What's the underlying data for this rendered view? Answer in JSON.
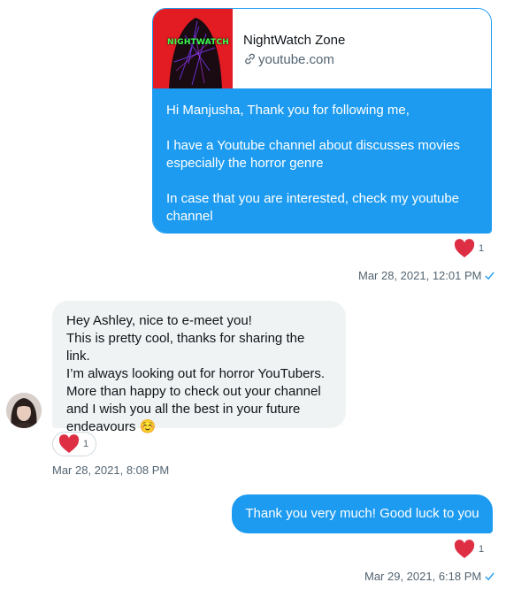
{
  "messages": [
    {
      "direction": "outgoing",
      "link_card": {
        "title": "NightWatch Zone",
        "domain": "youtube.com",
        "thumbnail_logo": "NIGHTWATCH"
      },
      "paragraphs": [
        "Hi Manjusha, Thank you for following me,",
        "I have a Youtube channel about discusses movies especially the horror genre",
        "In case that you are interested, check my youtube channel"
      ],
      "reaction": {
        "icon": "heart-icon",
        "count": "1"
      },
      "timestamp": "Mar 28, 2021, 12:01 PM"
    },
    {
      "direction": "incoming",
      "lines": [
        "Hey Ashley, nice to e-meet you!",
        "This is pretty cool, thanks for sharing the link.",
        "I’m always looking out for horror YouTubers.",
        "More than happy to check out your channel",
        "and I wish you all the best in your future",
        "endeavours ☺️"
      ],
      "reaction": {
        "icon": "heart-icon",
        "count": "1"
      },
      "timestamp": "Mar 28, 2021, 8:08 PM"
    },
    {
      "direction": "outgoing",
      "text": "Thank you very much! Good luck to you",
      "reaction": {
        "icon": "heart-icon",
        "count": "1"
      },
      "timestamp": "Mar 29, 2021, 6:18 PM"
    }
  ],
  "colors": {
    "accent": "#1d9bf0",
    "incoming_bubble": "#eff3f4",
    "heart": "#f91880",
    "muted_text": "#536471"
  }
}
